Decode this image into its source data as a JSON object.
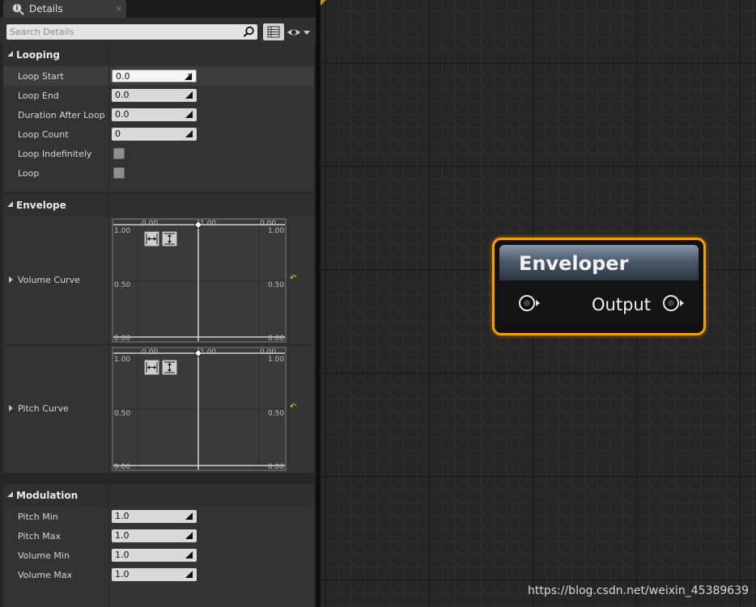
{
  "window": {
    "tab_label": "Details",
    "tab_close": "×"
  },
  "search": {
    "placeholder": "Search Details"
  },
  "sections": {
    "looping": {
      "title": "Looping"
    },
    "envelope": {
      "title": "Envelope"
    },
    "modulation": {
      "title": "Modulation"
    }
  },
  "looping": {
    "loop_start": {
      "label": "Loop Start",
      "value": "0.0"
    },
    "loop_end": {
      "label": "Loop End",
      "value": "0.0"
    },
    "duration_after_loop": {
      "label": "Duration After Loop",
      "value": "0.0"
    },
    "loop_count": {
      "label": "Loop Count",
      "value": "0"
    },
    "loop_indefinitely": {
      "label": "Loop Indefinitely",
      "checked": false
    },
    "loop": {
      "label": "Loop",
      "checked": false
    }
  },
  "envelope": {
    "volume_curve": {
      "label": "Volume Curve",
      "ticks": {
        "x_left": "0.00",
        "x_mid": "1.00",
        "x_right": "0.00",
        "y_top_left": "1.00",
        "y_top_right": "1.00",
        "y_mid_left": "0.50",
        "y_mid_right": "0.50",
        "y_bottom_left": "0.00",
        "y_bottom_right": "0.00"
      }
    },
    "pitch_curve": {
      "label": "Pitch Curve",
      "ticks": {
        "x_left": "0.00",
        "x_mid": "1.00",
        "x_right": "0.00",
        "y_top_left": "1.00",
        "y_top_right": "1.00",
        "y_mid_left": "0.50",
        "y_mid_right": "0.50",
        "y_bottom_left": "0.00",
        "y_bottom_right": "0.00"
      }
    }
  },
  "modulation": {
    "pitch_min": {
      "label": "Pitch Min",
      "value": "1.0"
    },
    "pitch_max": {
      "label": "Pitch Max",
      "value": "1.0"
    },
    "volume_min": {
      "label": "Volume Min",
      "value": "1.0"
    },
    "volume_max": {
      "label": "Volume Max",
      "value": "1.0"
    }
  },
  "node": {
    "title": "Enveloper",
    "output_label": "Output",
    "border_color": "#f2a000"
  },
  "watermark": "https://blog.csdn.net/weixin_45389639",
  "icons": [
    "details-icon",
    "search-icon",
    "list-view-icon",
    "eye-icon",
    "drag-handle-icon",
    "fit-horizontal-icon",
    "fit-vertical-icon",
    "reset-arrow-icon",
    "pin-icon"
  ]
}
